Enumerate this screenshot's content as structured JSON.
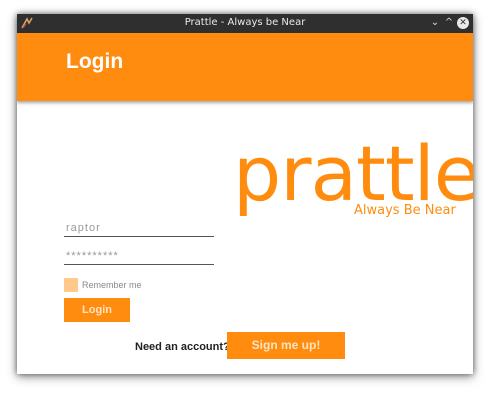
{
  "window": {
    "title": "Prattle - Always be Near",
    "controls": {
      "minimize": "⌄",
      "maximize": "^",
      "close": "✕"
    }
  },
  "header": {
    "title": "Login"
  },
  "brand": {
    "name": "prattle",
    "tagline": "Always Be Near"
  },
  "form": {
    "username_value": "raptor",
    "password_value": "**********",
    "remember_label": "Remember me",
    "login_label": "Login"
  },
  "signup": {
    "prompt": "Need an account?",
    "button_label": "Sign me up!"
  },
  "colors": {
    "accent": "#ff8c0f",
    "titlebar": "#2f2f2f"
  }
}
